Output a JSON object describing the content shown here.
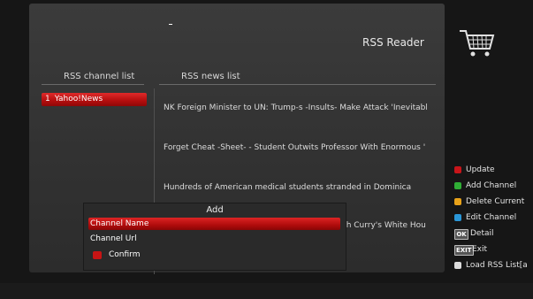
{
  "header": {
    "title": "RSS Reader"
  },
  "channel_list": {
    "header": "RSS channel list",
    "items": [
      {
        "number": "1",
        "name": "Yahoo!News"
      }
    ]
  },
  "news_list": {
    "header": "RSS news list",
    "items": [
      "NK Foreign Minister to UN: Trump-s -Insults- Make Attack 'Inevitabl",
      "Forget Cheat -Sheet- - Student Outwits Professor With Enormous '",
      "Hundreds of American medical students stranded in Dominica",
      "sh Curry's White Hou"
    ]
  },
  "legend": [
    {
      "label": "Update",
      "color": "#c8151a"
    },
    {
      "label": "Add Channel",
      "color": "#2fae35"
    },
    {
      "label": "Delete Current",
      "color": "#e8a21a"
    },
    {
      "label": "Edit Channel",
      "color": "#2a97d8"
    },
    {
      "label": "Detail",
      "badge": "OK"
    },
    {
      "label": "Exit",
      "badge": "EXIT"
    },
    {
      "label": "Load RSS List[a",
      "color": "#dcdcdc"
    }
  ],
  "dialog": {
    "title": "Add",
    "channel_name_label": "Channel Name",
    "channel_url_label": "Channel Url",
    "confirm_label": "Confirm"
  }
}
